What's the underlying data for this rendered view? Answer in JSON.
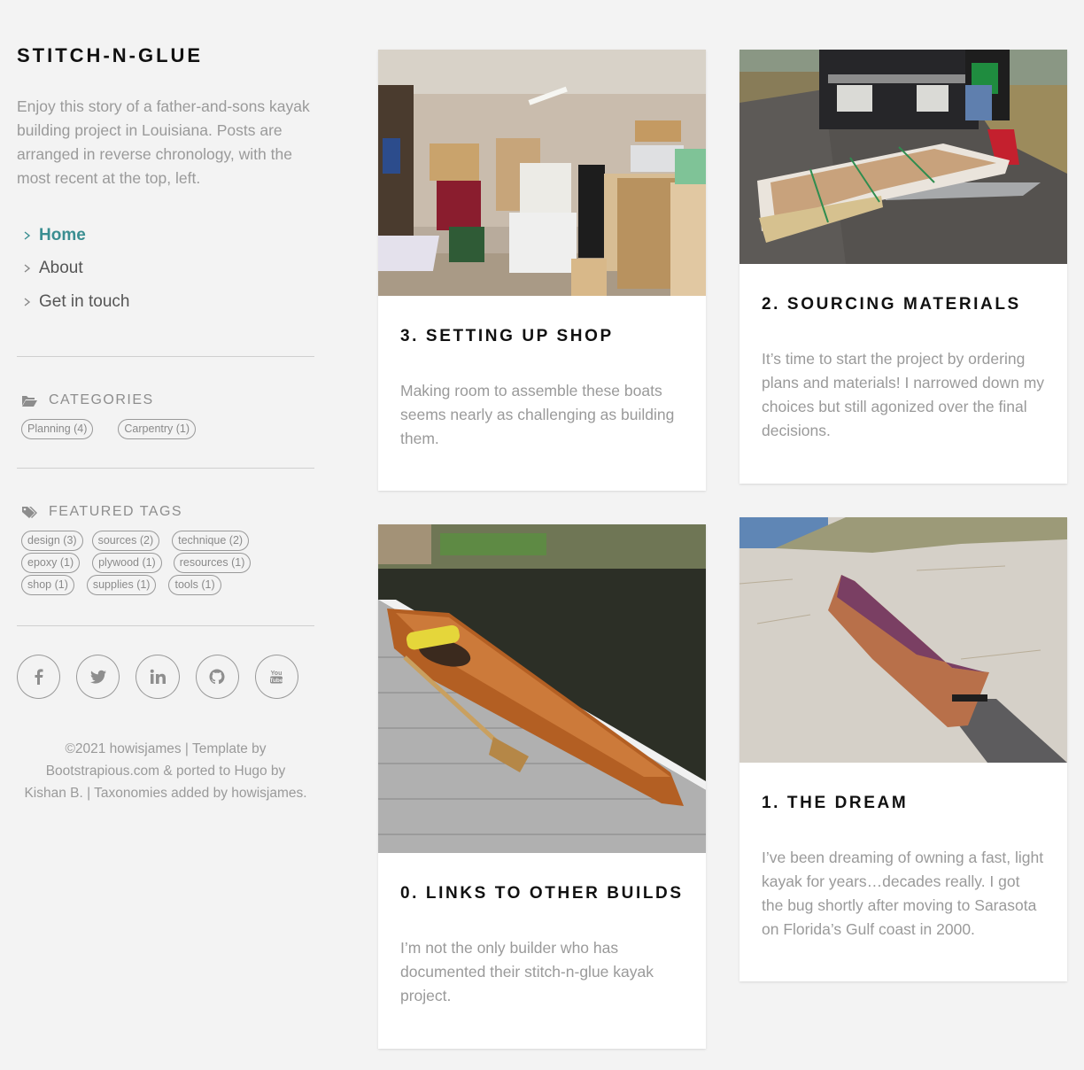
{
  "site": {
    "title": "STITCH-N-GLUE",
    "description": "Enjoy this story of a father-and-sons kayak building project in Louisiana. Posts are arranged in reverse chronology, with the most recent at the top, left."
  },
  "nav": {
    "items": [
      {
        "label": "Home",
        "active": true
      },
      {
        "label": "About",
        "active": false
      },
      {
        "label": "Get in touch",
        "active": false
      }
    ],
    "accent_color": "#3a8e91"
  },
  "categories": {
    "heading": "CATEGORIES",
    "icon": "folder-open-icon",
    "items": [
      "Planning (4)",
      "Carpentry (1)"
    ]
  },
  "tags": {
    "heading": "FEATURED TAGS",
    "icon": "tags-icon",
    "rows": [
      [
        "design (3)",
        "sources (2)",
        "technique (2)"
      ],
      [
        "epoxy (1)",
        "plywood (1)",
        "resources (1)"
      ],
      [
        "shop (1)",
        "supplies (1)",
        "tools (1)"
      ]
    ]
  },
  "social": [
    "facebook-icon",
    "twitter-icon",
    "linkedin-icon",
    "github-icon",
    "youtube-icon"
  ],
  "footer": {
    "line1": "©2021 howisjames | Template by",
    "line2": "Bootstrapious.com & ported to Hugo by",
    "line3": "Kishan B. | Taxonomies added by howisjames."
  },
  "posts": [
    {
      "title": "3. SETTING UP SHOP",
      "excerpt": "Making room to assemble these boats seems nearly as challenging as building them.",
      "image": "cluttered garage with boxes, shelves and plywood sheets"
    },
    {
      "title": "2. SOURCING MATERIALS",
      "excerpt": "It’s time to start the project by ordering plans and materials! I narrowed down my choices but still agonized over the final decisions.",
      "image": "wrapped plywood pallet on truck liftgate"
    },
    {
      "title": "0. LINKS TO OTHER BUILDS",
      "excerpt": "I’m not the only builder who has documented their stitch-n-glue kayak project.",
      "image": "finished wooden kayak on a dock beside water"
    },
    {
      "title": "1. THE DREAM",
      "excerpt": "I’ve been dreaming of owning a fast, light kayak for years…decades really. I got the bug shortly after moving to Sarasota on Florida’s Gulf coast in 2000.",
      "image": "wooden kayak on a sandy beach"
    }
  ]
}
